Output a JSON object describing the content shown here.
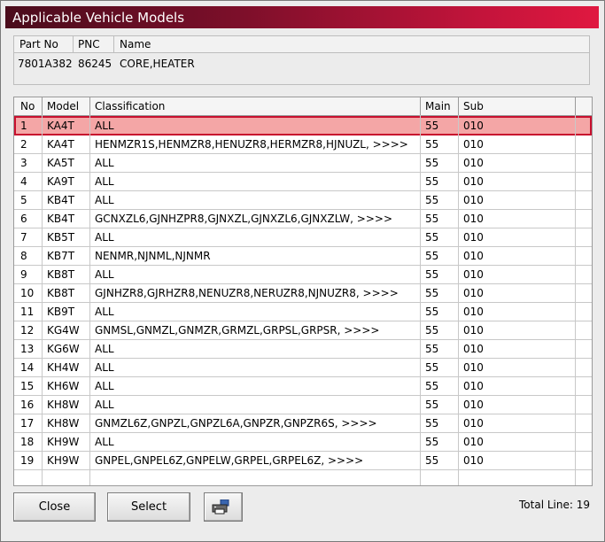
{
  "window": {
    "title": "Applicable Vehicle Models"
  },
  "part": {
    "headers": {
      "part_no": "Part No",
      "pnc": "PNC",
      "name": "Name"
    },
    "values": {
      "part_no": "7801A382",
      "pnc": "86245",
      "name": "CORE,HEATER"
    }
  },
  "table": {
    "headers": {
      "no": "No",
      "model": "Model",
      "classification": "Classification",
      "main": "Main",
      "sub": "Sub"
    },
    "rows": [
      {
        "no": "1",
        "model": "KA4T",
        "classification": "ALL",
        "main": "55",
        "sub": "010"
      },
      {
        "no": "2",
        "model": "KA4T",
        "classification": "HENMZR1S,HENMZR8,HENUZR8,HERMZR8,HJNUZL,  >>>>",
        "main": "55",
        "sub": "010"
      },
      {
        "no": "3",
        "model": "KA5T",
        "classification": "ALL",
        "main": "55",
        "sub": "010"
      },
      {
        "no": "4",
        "model": "KA9T",
        "classification": "ALL",
        "main": "55",
        "sub": "010"
      },
      {
        "no": "5",
        "model": "KB4T",
        "classification": "ALL",
        "main": "55",
        "sub": "010"
      },
      {
        "no": "6",
        "model": "KB4T",
        "classification": "GCNXZL6,GJNHZPR8,GJNXZL,GJNXZL6,GJNXZLW,  >>>>",
        "main": "55",
        "sub": "010"
      },
      {
        "no": "7",
        "model": "KB5T",
        "classification": "ALL",
        "main": "55",
        "sub": "010"
      },
      {
        "no": "8",
        "model": "KB7T",
        "classification": "NENMR,NJNML,NJNMR",
        "main": "55",
        "sub": "010"
      },
      {
        "no": "9",
        "model": "KB8T",
        "classification": "ALL",
        "main": "55",
        "sub": "010"
      },
      {
        "no": "10",
        "model": "KB8T",
        "classification": "GJNHZR8,GJRHZR8,NENUZR8,NERUZR8,NJNUZR8,  >>>>",
        "main": "55",
        "sub": "010"
      },
      {
        "no": "11",
        "model": "KB9T",
        "classification": "ALL",
        "main": "55",
        "sub": "010"
      },
      {
        "no": "12",
        "model": "KG4W",
        "classification": "GNMSL,GNMZL,GNMZR,GRMZL,GRPSL,GRPSR,  >>>>",
        "main": "55",
        "sub": "010"
      },
      {
        "no": "13",
        "model": "KG6W",
        "classification": "ALL",
        "main": "55",
        "sub": "010"
      },
      {
        "no": "14",
        "model": "KH4W",
        "classification": "ALL",
        "main": "55",
        "sub": "010"
      },
      {
        "no": "15",
        "model": "KH6W",
        "classification": "ALL",
        "main": "55",
        "sub": "010"
      },
      {
        "no": "16",
        "model": "KH8W",
        "classification": "ALL",
        "main": "55",
        "sub": "010"
      },
      {
        "no": "17",
        "model": "KH8W",
        "classification": "GNMZL6Z,GNPZL,GNPZL6A,GNPZR,GNPZR6S,  >>>>",
        "main": "55",
        "sub": "010"
      },
      {
        "no": "18",
        "model": "KH9W",
        "classification": "ALL",
        "main": "55",
        "sub": "010"
      },
      {
        "no": "19",
        "model": "KH9W",
        "classification": "GNPEL,GNPEL6Z,GNPELW,GRPEL,GRPEL6Z,  >>>>",
        "main": "55",
        "sub": "010"
      }
    ],
    "selected_row": "1"
  },
  "buttons": {
    "close": "Close",
    "select": "Select",
    "print_icon": "printer-icon"
  },
  "footer": {
    "total_line": "Total Line: 19"
  },
  "colors": {
    "title_start": "#4a0c1c",
    "title_end": "#e01840",
    "selection_fill": "#f4a6a6",
    "selection_border": "#c8102e"
  }
}
